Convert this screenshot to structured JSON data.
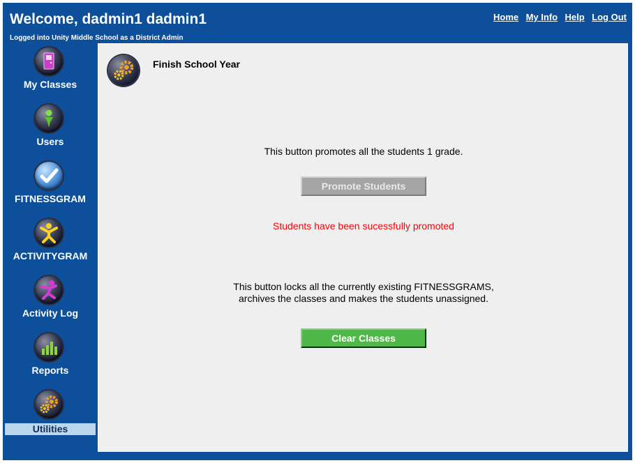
{
  "header": {
    "title": "Welcome, dadmin1 dadmin1",
    "subtitle": "Logged into Unity Middle School as a District Admin",
    "links": [
      "Home",
      "My Info",
      "Help",
      "Log Out"
    ]
  },
  "sidebar": {
    "items": [
      {
        "label": "My Classes",
        "icon": "door-icon"
      },
      {
        "label": "Users",
        "icon": "person-icon"
      },
      {
        "label": "FITNESSGRAM",
        "icon": "checkmark-icon"
      },
      {
        "label": "ACTIVITYGRAM",
        "icon": "active-figure-icon"
      },
      {
        "label": "Activity Log",
        "icon": "running-figure-icon"
      },
      {
        "label": "Reports",
        "icon": "bar-chart-icon"
      },
      {
        "label": "Utilities",
        "icon": "gears-icon",
        "active": true
      }
    ]
  },
  "main": {
    "page_title": "Finish School Year",
    "page_icon": "gears-icon",
    "promote_description": "This button promotes all the students 1 grade.",
    "promote_button": "Promote Students",
    "promote_button_enabled": false,
    "promote_status": "Students have been sucessfully promoted",
    "clear_description_line1": "This button locks all the currently existing FITNESSGRAMS,",
    "clear_description_line2": "archives the classes and makes the students unassigned.",
    "clear_button": "Clear Classes"
  },
  "colors": {
    "frame_blue": "#0d4f9a",
    "content_bg": "#efefef",
    "status_red": "#ff0000",
    "clear_green": "#4fb848",
    "disabled_gray": "#a5a5a5",
    "active_nav_bg": "#bcd6ec"
  }
}
